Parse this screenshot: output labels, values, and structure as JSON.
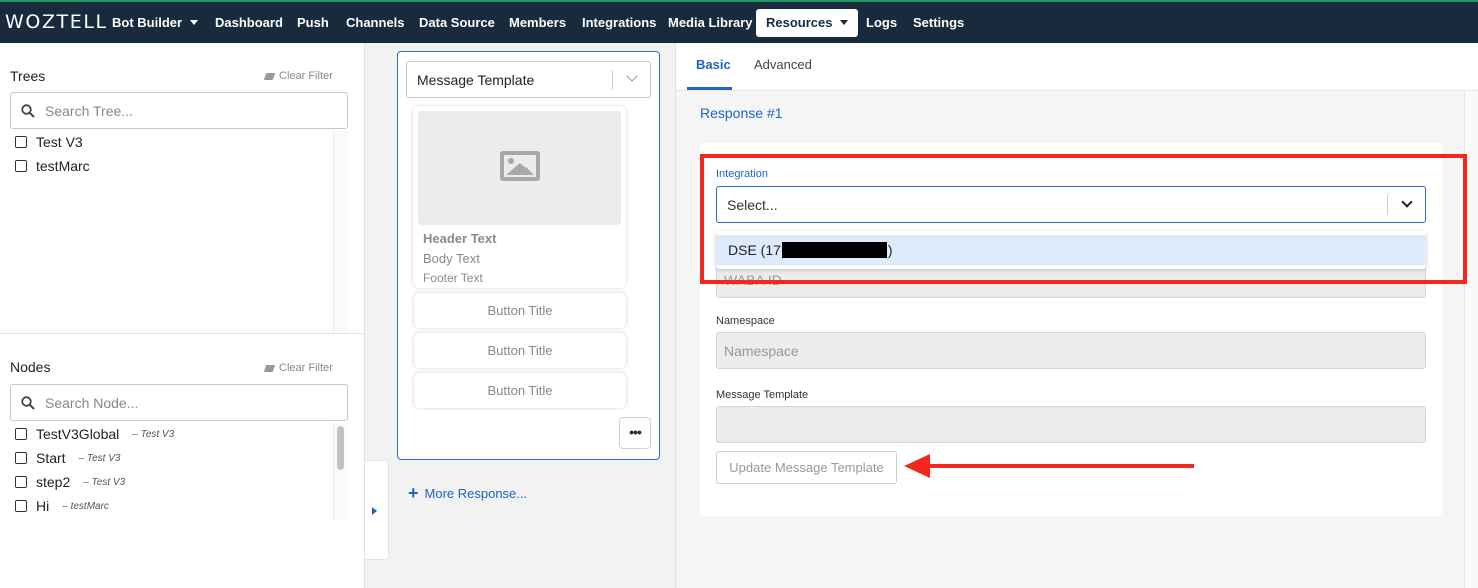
{
  "nav": {
    "logo": "WOZTELL",
    "items": [
      "Bot Builder",
      "Dashboard",
      "Push",
      "Channels",
      "Data Source",
      "Members",
      "Integrations",
      "Media Library",
      "Resources",
      "Logs",
      "Settings"
    ],
    "active": "Resources"
  },
  "trees": {
    "title": "Trees",
    "clear_filter": "Clear Filter",
    "search_placeholder": "Search Tree...",
    "items": [
      "Test V3",
      "testMarc"
    ]
  },
  "nodes": {
    "title": "Nodes",
    "clear_filter": "Clear Filter",
    "search_placeholder": "Search Node...",
    "items": [
      {
        "name": "TestV3Global",
        "tree": "Test V3"
      },
      {
        "name": "Start",
        "tree": "Test V3"
      },
      {
        "name": "step2",
        "tree": "Test V3"
      },
      {
        "name": "Hi",
        "tree": "testMarc"
      }
    ]
  },
  "response_card": {
    "type": "Message Template",
    "header_text": "Header Text",
    "body_text": "Body Text",
    "footer_text": "Footer Text",
    "buttons": [
      "Button Title",
      "Button Title",
      "Button Title"
    ],
    "more_label": "•••",
    "more_response": "More Response..."
  },
  "editor": {
    "tabs": [
      "Basic",
      "Advanced"
    ],
    "active_tab": "Basic",
    "response_label": "Response #1",
    "integration": {
      "label": "Integration",
      "placeholder": "Select...",
      "option_prefix": "DSE (17",
      "option_suffix": ")"
    },
    "waba_id": {
      "placeholder": "WABA ID"
    },
    "namespace": {
      "label": "Namespace",
      "placeholder": "Namespace"
    },
    "message_template": {
      "label": "Message Template",
      "value": ""
    },
    "update_button": "Update Message Template"
  },
  "colors": {
    "nav_bg": "#172b3d",
    "accent": "#1f63c4",
    "annotation": "#f2271e"
  }
}
